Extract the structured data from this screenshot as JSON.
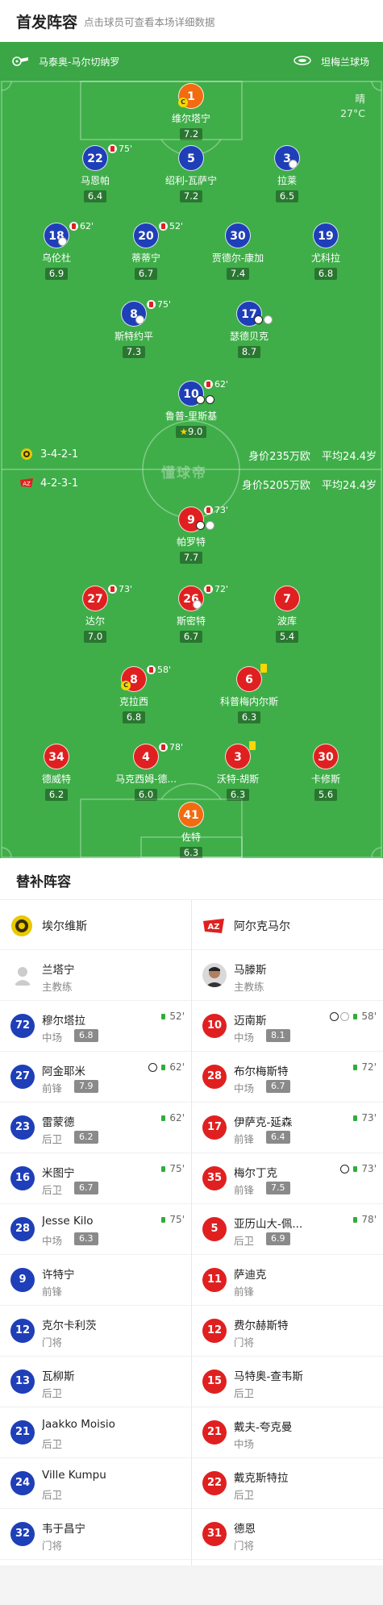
{
  "header": {
    "title": "首发阵容",
    "subtitle": "点击球员可查看本场详细数据"
  },
  "match": {
    "referee": "马泰奥-马尔切纳罗",
    "stadium": "坦梅兰球场",
    "weather": "晴",
    "temperature": "27°C"
  },
  "home": {
    "formation": "3-4-2-1",
    "value": "身价235万欧",
    "avg_age": "平均24.4岁",
    "color": "#1f3fb8",
    "players": [
      {
        "num": "1",
        "name": "维尔塔宁",
        "rating": "7.2",
        "gk": true,
        "captain": true
      },
      {
        "num": "22",
        "name": "马恩帕",
        "rating": "6.4",
        "sub": "75'"
      },
      {
        "num": "5",
        "name": "绍利-瓦萨宁",
        "rating": "7.2"
      },
      {
        "num": "3",
        "name": "拉莱",
        "rating": "6.5"
      },
      {
        "num": "18",
        "name": "乌伦杜",
        "rating": "6.9",
        "sub": "62'"
      },
      {
        "num": "20",
        "name": "蒂蒂宁",
        "rating": "6.7",
        "sub": "52'"
      },
      {
        "num": "30",
        "name": "贾德尔-康加",
        "rating": "7.4"
      },
      {
        "num": "19",
        "name": "尤科拉",
        "rating": "6.8"
      },
      {
        "num": "8",
        "name": "斯特约平",
        "rating": "7.3",
        "sub": "75'"
      },
      {
        "num": "17",
        "name": "瑟德贝克",
        "rating": "8.7"
      },
      {
        "num": "10",
        "name": "鲁普-里斯基",
        "rating": "9.0",
        "sub": "62'",
        "best": true
      }
    ]
  },
  "away": {
    "formation": "4-2-3-1",
    "value": "身价5205万欧",
    "avg_age": "平均24.4岁",
    "color": "#e02020",
    "players": [
      {
        "num": "9",
        "name": "帕罗特",
        "rating": "7.7",
        "sub": "73'"
      },
      {
        "num": "27",
        "name": "达尔",
        "rating": "7.0",
        "sub": "73'"
      },
      {
        "num": "26",
        "name": "斯密特",
        "rating": "6.7",
        "sub": "72'"
      },
      {
        "num": "7",
        "name": "波库",
        "rating": "5.4"
      },
      {
        "num": "8",
        "name": "克拉西",
        "rating": "6.8",
        "sub": "58'",
        "captain": true
      },
      {
        "num": "6",
        "name": "科普梅内尔斯",
        "rating": "6.3"
      },
      {
        "num": "34",
        "name": "德威特",
        "rating": "6.2"
      },
      {
        "num": "4",
        "name": "马克西姆-德...",
        "rating": "6.0",
        "sub": "78'"
      },
      {
        "num": "3",
        "name": "沃特-胡斯",
        "rating": "6.3"
      },
      {
        "num": "30",
        "name": "卡修斯",
        "rating": "5.6"
      },
      {
        "num": "41",
        "name": "佐特",
        "rating": "6.3",
        "gk": true
      }
    ]
  },
  "subs": {
    "title": "替补阵容",
    "home_team": "埃尔维斯",
    "away_team": "阿尔克马尔",
    "home_coach": {
      "name": "兰塔宁",
      "role": "主教练"
    },
    "away_coach": {
      "name": "马滕斯",
      "role": "主教练"
    },
    "home": [
      {
        "num": "72",
        "name": "穆尔塔拉",
        "pos": "中场",
        "rating": "6.8",
        "min": "52'"
      },
      {
        "num": "27",
        "name": "阿金耶米",
        "pos": "前锋",
        "rating": "7.9",
        "min": "62'"
      },
      {
        "num": "23",
        "name": "雷蒙德",
        "pos": "后卫",
        "rating": "6.2",
        "min": "62'"
      },
      {
        "num": "16",
        "name": "米图宁",
        "pos": "后卫",
        "rating": "6.7",
        "min": "75'"
      },
      {
        "num": "28",
        "name": "Jesse Kilo",
        "pos": "中场",
        "rating": "6.3",
        "min": "75'"
      },
      {
        "num": "9",
        "name": "许特宁",
        "pos": "前锋"
      },
      {
        "num": "12",
        "name": "克尔卡利茨",
        "pos": "门将"
      },
      {
        "num": "13",
        "name": "瓦柳斯",
        "pos": "后卫"
      },
      {
        "num": "21",
        "name": "Jaakko Moisio",
        "pos": "后卫"
      },
      {
        "num": "24",
        "name": "Ville Kumpu",
        "pos": "后卫"
      },
      {
        "num": "32",
        "name": "韦于昌宁",
        "pos": "门将"
      }
    ],
    "away": [
      {
        "num": "10",
        "name": "迈南斯",
        "pos": "中场",
        "rating": "8.1",
        "min": "58'"
      },
      {
        "num": "28",
        "name": "布尔梅斯特",
        "pos": "中场",
        "rating": "6.7",
        "min": "72'"
      },
      {
        "num": "17",
        "name": "伊萨克-延森",
        "pos": "前锋",
        "rating": "6.4",
        "min": "73'"
      },
      {
        "num": "35",
        "name": "梅尔丁克",
        "pos": "前锋",
        "rating": "7.5",
        "min": "73'"
      },
      {
        "num": "5",
        "name": "亚历山大-佩...",
        "pos": "后卫",
        "rating": "6.9",
        "min": "78'"
      },
      {
        "num": "11",
        "name": "萨迪克",
        "pos": "前锋"
      },
      {
        "num": "12",
        "name": "费尔赫斯特",
        "pos": "门将"
      },
      {
        "num": "15",
        "name": "马特奥-查韦斯",
        "pos": "后卫"
      },
      {
        "num": "21",
        "name": "戴夫-夸克曼",
        "pos": "中场"
      },
      {
        "num": "22",
        "name": "戴克斯特拉",
        "pos": "后卫"
      },
      {
        "num": "31",
        "name": "德恩",
        "pos": "门将"
      }
    ]
  },
  "watermark": "懂球帝"
}
